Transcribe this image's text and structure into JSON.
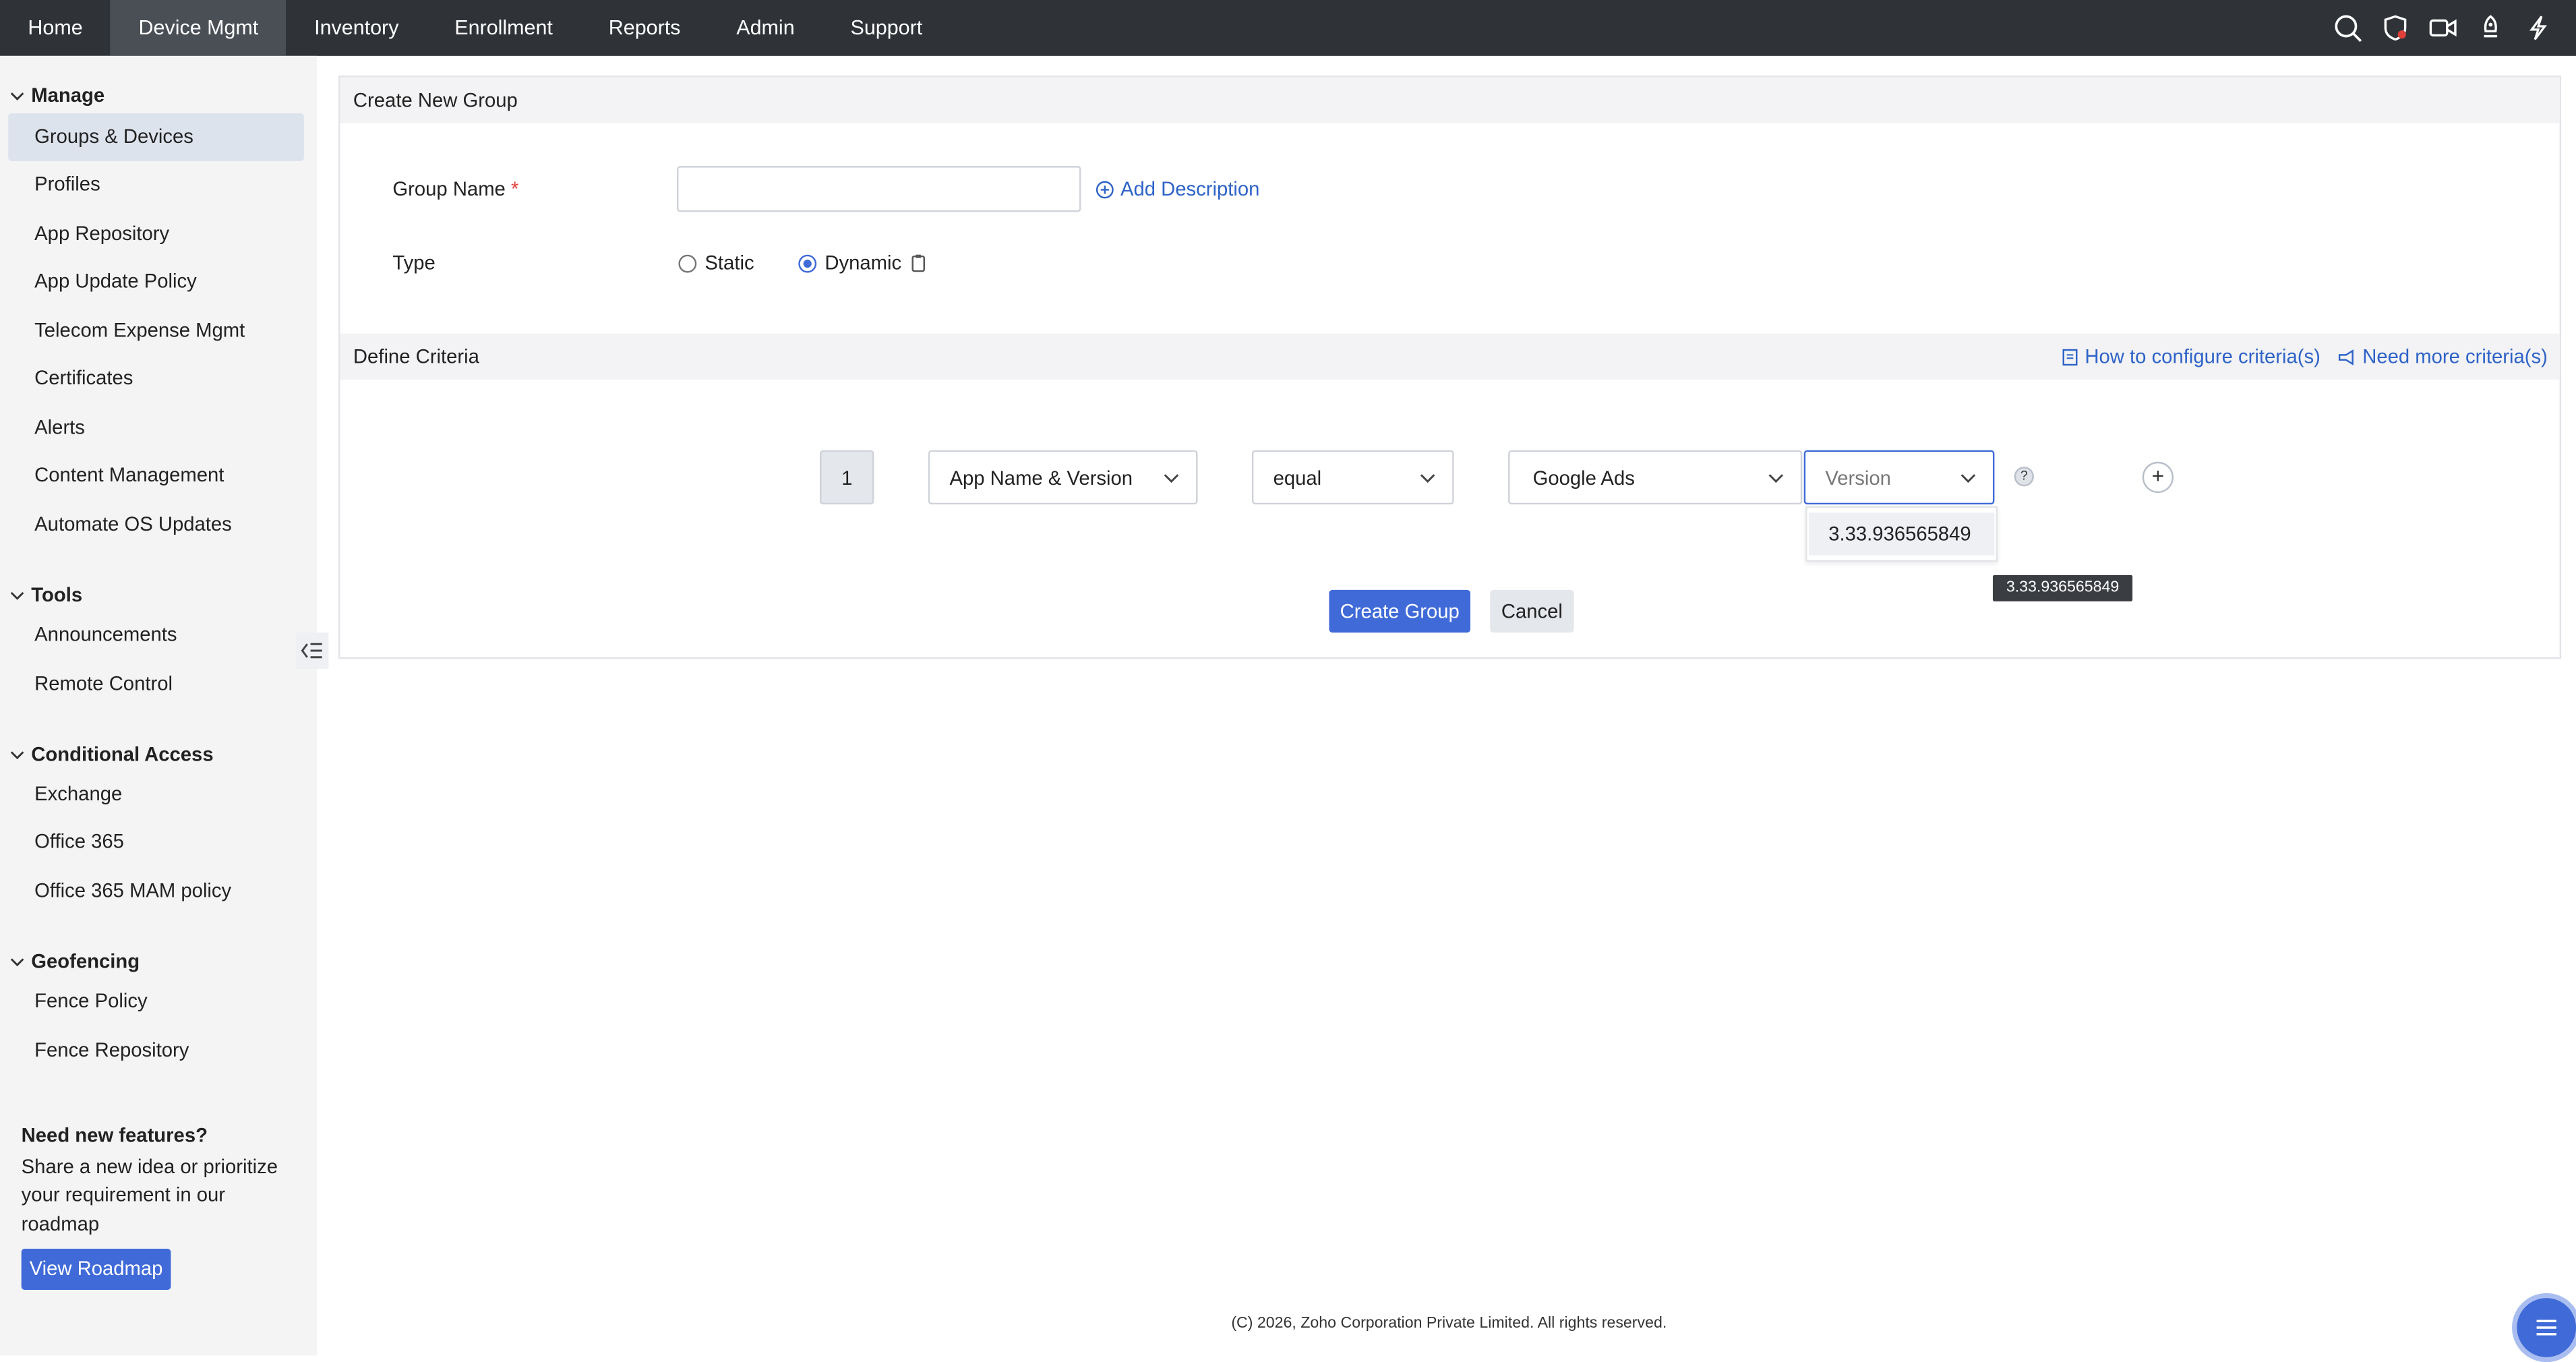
{
  "topnav": {
    "items": [
      "Home",
      "Device Mgmt",
      "Inventory",
      "Enrollment",
      "Reports",
      "Admin",
      "Support"
    ],
    "active_index": 1,
    "icons": [
      "search-icon",
      "shield-icon",
      "video-icon",
      "rocket-icon",
      "lightning-icon"
    ]
  },
  "sidebar": {
    "manage_title": "Manage",
    "manage_items": [
      "Groups & Devices",
      "Profiles",
      "App Repository",
      "App Update Policy",
      "Telecom Expense Mgmt",
      "Certificates",
      "Alerts",
      "Content Management",
      "Automate OS Updates"
    ],
    "tools_title": "Tools",
    "tools_items": [
      "Announcements",
      "Remote Control"
    ],
    "ca_title": "Conditional Access",
    "ca_items": [
      "Exchange",
      "Office 365",
      "Office 365 MAM policy"
    ],
    "geo_title": "Geofencing",
    "geo_items": [
      "Fence Policy",
      "Fence Repository"
    ],
    "promo_title": "Need new features?",
    "promo_text": "Share a new idea or prioritize your requirement in our roadmap",
    "promo_button": "View Roadmap"
  },
  "form": {
    "header": "Create New Group",
    "group_name_label": "Group Name",
    "required_mark": "*",
    "group_name_value": "",
    "add_description": "Add Description",
    "type_label": "Type",
    "type_options": [
      "Static",
      "Dynamic"
    ],
    "type_selected": "Dynamic",
    "criteria_header": "Define Criteria",
    "how_to_link": "How to configure criteria(s)",
    "need_more_link": "Need more criteria(s)",
    "criteria": {
      "index": "1",
      "field": "App Name & Version",
      "operator": "equal",
      "app": "Google Ads",
      "version_placeholder": "Version",
      "version_options": [
        "3.33.936565849"
      ],
      "tooltip": "3.33.936565849",
      "help": "?",
      "add": "+"
    },
    "create_button": "Create Group",
    "cancel_button": "Cancel"
  },
  "footer": {
    "text": "(C) 2026, Zoho Corporation Private Limited. All rights reserved."
  }
}
